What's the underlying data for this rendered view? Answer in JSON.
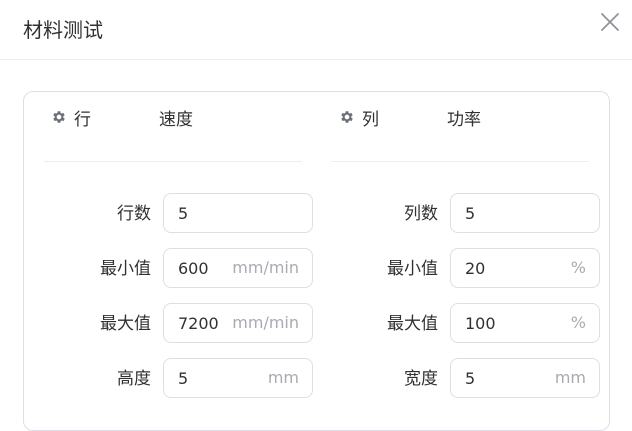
{
  "dialog": {
    "title": "材料测试",
    "close_icon": "close-icon"
  },
  "row_section": {
    "icon": "gear-icon",
    "heading": "行",
    "parameter": "速度",
    "count_label": "行数",
    "count_value": "5",
    "min_label": "最小值",
    "min_value": "600",
    "min_unit": "mm/min",
    "max_label": "最大值",
    "max_value": "7200",
    "max_unit": "mm/min",
    "size_label": "高度",
    "size_value": "5",
    "size_unit": "mm"
  },
  "column_section": {
    "icon": "gear-icon",
    "heading": "列",
    "parameter": "功率",
    "count_label": "列数",
    "count_value": "5",
    "min_label": "最小值",
    "min_value": "20",
    "min_unit": "%",
    "max_label": "最大值",
    "max_value": "100",
    "max_unit": "%",
    "size_label": "宽度",
    "size_value": "5",
    "size_unit": "mm"
  }
}
